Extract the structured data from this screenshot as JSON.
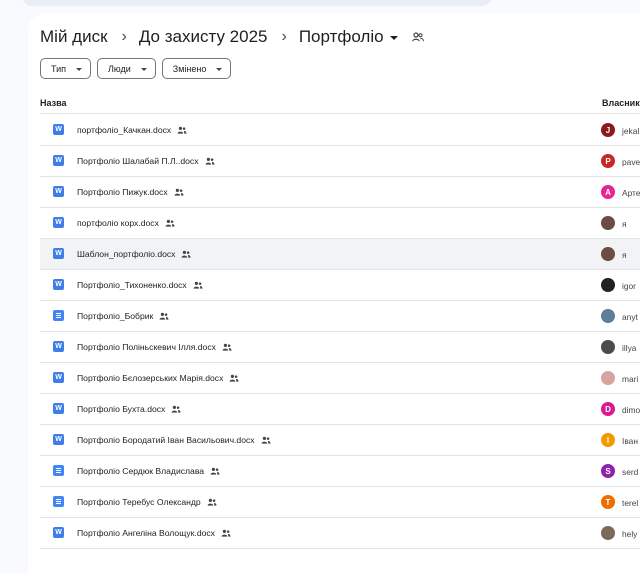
{
  "breadcrumb": {
    "root": "Мій диск",
    "parent": "До захисту 2025",
    "current": "Портфоліо"
  },
  "filters": [
    {
      "label": "Тип"
    },
    {
      "label": "Люди"
    },
    {
      "label": "Змінено"
    }
  ],
  "columns": {
    "name": "Назва",
    "owner": "Власник"
  },
  "files": [
    {
      "name": "портфоліо_Качкан.docx",
      "type": "word",
      "owner": "jekal",
      "avatar_letter": "J",
      "avatar_color": "#8b1a1a"
    },
    {
      "name": "Портфоліо Шалабай П.Л..docx",
      "type": "word",
      "owner": "pave",
      "avatar_letter": "P",
      "avatar_color": "#c62828"
    },
    {
      "name": "Портфоліо Пижук.docx",
      "type": "word",
      "owner": "Арте",
      "avatar_letter": "А",
      "avatar_color": "#e52592"
    },
    {
      "name": "портфоліо корх.docx",
      "type": "word",
      "owner": "я",
      "avatar_letter": "",
      "avatar_color": "#6d4c41"
    },
    {
      "name": "Шаблон_портфоліо.docx",
      "type": "word",
      "owner": "я",
      "avatar_letter": "",
      "avatar_color": "#6d4c41",
      "highlighted": true
    },
    {
      "name": "Портфоліо_Тихоненко.docx",
      "type": "word",
      "owner": "igor",
      "avatar_letter": "",
      "avatar_color": "#212121"
    },
    {
      "name": "Портфоліо_Бобрик",
      "type": "gdoc",
      "owner": "anyt",
      "avatar_letter": "",
      "avatar_color": "#5f7d95"
    },
    {
      "name": "Портфоліо Поліньскевич Ілля.docx",
      "type": "word",
      "owner": "illya",
      "avatar_letter": "",
      "avatar_color": "#4e4a47"
    },
    {
      "name": "Портфоліо Бєлозерських Марія.docx",
      "type": "word",
      "owner": "mari",
      "avatar_letter": "",
      "avatar_color": "#d7a4a4"
    },
    {
      "name": "Портфоліо Бухта.docx",
      "type": "word",
      "owner": "dimo",
      "avatar_letter": "D",
      "avatar_color": "#d81b93"
    },
    {
      "name": "Портфоліо Бородатий Іван Васильович.docx",
      "type": "word",
      "owner": "Іван",
      "avatar_letter": "І",
      "avatar_color": "#f29900"
    },
    {
      "name": "Портфоліо Сердюк Владислава",
      "type": "gdoc",
      "owner": "serd",
      "avatar_letter": "S",
      "avatar_color": "#8e24aa"
    },
    {
      "name": "Портфоліо Теребус Олександр",
      "type": "gdoc",
      "owner": "terel",
      "avatar_letter": "T",
      "avatar_color": "#ef6c00"
    },
    {
      "name": "Портфоліо Ангеліна Волощук.docx",
      "type": "word",
      "owner": "hely",
      "avatar_letter": "",
      "avatar_color": "#7a6a5a"
    }
  ]
}
